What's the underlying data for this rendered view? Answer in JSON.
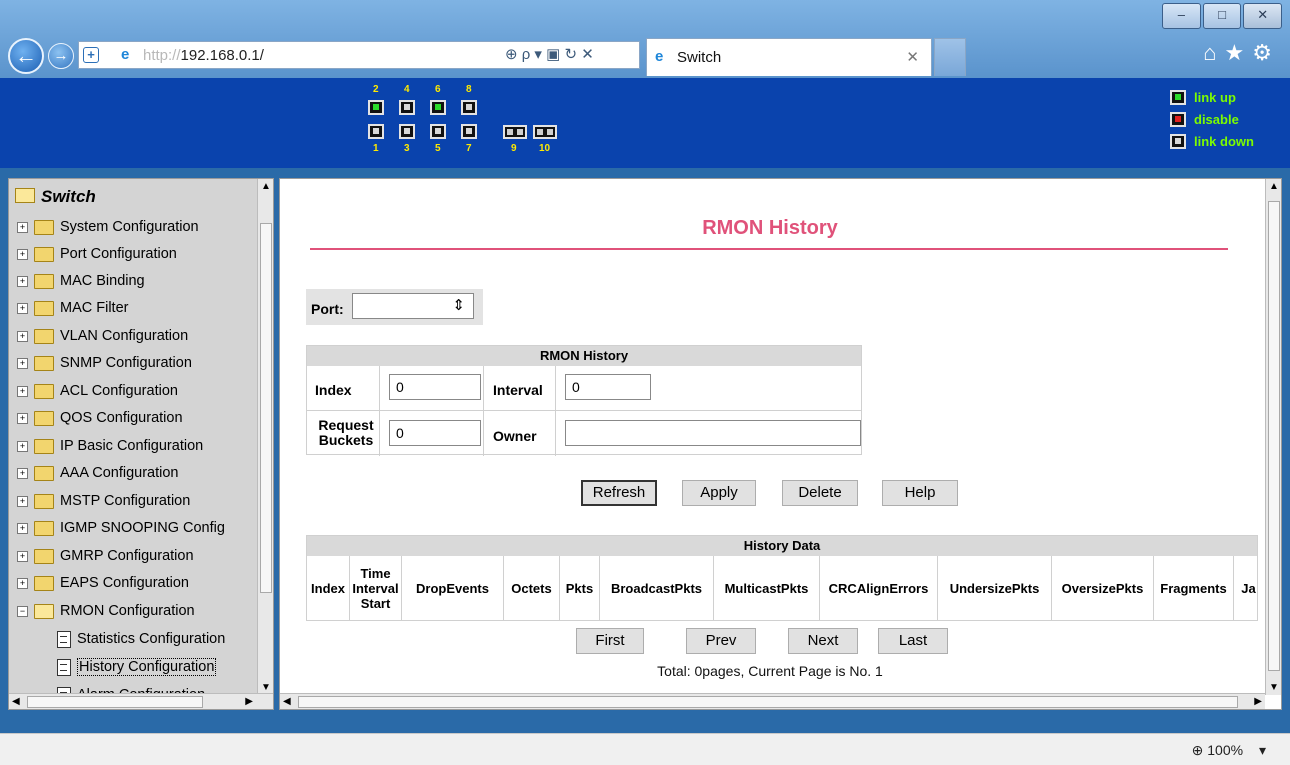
{
  "browser": {
    "url_prefix": "http://",
    "url_host": "192.168.0.1/",
    "tab_title": "Switch",
    "zoom": "100%",
    "window_buttons": [
      "–",
      "□",
      "✕"
    ],
    "nav_tools": "⊕ ρ ▾ ▣ ↻ ✕",
    "right_tools": "⌂★⚙"
  },
  "panel": {
    "top_ports": [
      "2",
      "4",
      "6",
      "8"
    ],
    "bottom_ports": [
      "1",
      "3",
      "5",
      "7"
    ],
    "sfp_ports": [
      "9",
      "10"
    ],
    "legend": [
      {
        "label": "link up",
        "state": "up"
      },
      {
        "label": "disable",
        "state": "disable"
      },
      {
        "label": "link down",
        "state": "down"
      }
    ],
    "port_up_color": "#2bdc2b",
    "port_disable_color": "#e02020"
  },
  "tree": {
    "root": "Switch",
    "items": [
      "System Configuration",
      "Port Configuration",
      "MAC Binding",
      "MAC Filter",
      "VLAN Configuration",
      "SNMP Configuration",
      "ACL Configuration",
      "QOS Configuration",
      "IP Basic Configuration",
      "AAA Configuration",
      "MSTP Configuration",
      "IGMP SNOOPING Config",
      "GMRP Configuration",
      "EAPS Configuration",
      "RMON Configuration"
    ],
    "children": [
      "Statistics Configuration",
      "History Configuration",
      "Alarm Configuration"
    ]
  },
  "main": {
    "title": "RMON History",
    "title_color": "#e0527a",
    "port_label": "Port:",
    "port_value": "",
    "section_title": "RMON History",
    "index_label": "Index",
    "index_value": "0",
    "interval_label": "Interval",
    "interval_value": "0",
    "buckets_label": "Request Buckets",
    "buckets_value": "0",
    "owner_label": "Owner",
    "owner_value": "",
    "buttons": {
      "refresh": "Refresh",
      "apply": "Apply",
      "delete": "Delete",
      "help": "Help"
    },
    "data_title": "History Data",
    "columns": [
      "Index",
      "Time Interval Start",
      "DropEvents",
      "Octets",
      "Pkts",
      "BroadcastPkts",
      "MulticastPkts",
      "CRCAlignErrors",
      "UndersizePkts",
      "OversizePkts",
      "Fragments",
      "Ja"
    ],
    "pager": {
      "first": "First",
      "prev": "Prev",
      "next": "Next",
      "last": "Last"
    },
    "total": "Total: 0pages, Current Page is No. 1"
  }
}
